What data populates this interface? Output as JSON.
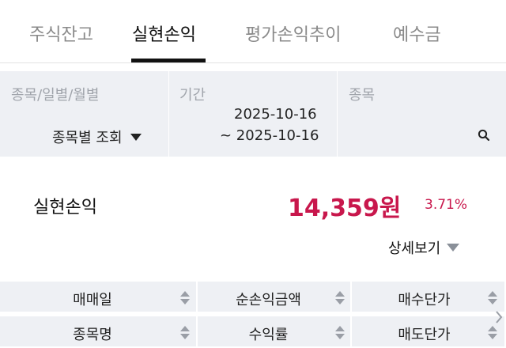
{
  "tabs": [
    {
      "label": "주식잔고",
      "active": false
    },
    {
      "label": "실현손익",
      "active": true
    },
    {
      "label": "평가손익추이",
      "active": false
    },
    {
      "label": "예수금",
      "active": false
    }
  ],
  "filters": {
    "type_label": "종목/일별/월별",
    "type_value": "종목별 조회",
    "period_label": "기간",
    "period_start": "2025-10-16",
    "period_end": "~ 2025-10-16",
    "stock_label": "종목",
    "stock_value": ""
  },
  "summary": {
    "label": "실현손익",
    "amount": "14,359원",
    "rate": "3.71%",
    "color": "#c8174c"
  },
  "detail_label": "상세보기",
  "table": {
    "header_row1": [
      "매매일",
      "순손익금액",
      "매수단가"
    ],
    "header_row2": [
      "종목명",
      "수익률",
      "매도단가"
    ]
  },
  "icons": {
    "search": "search-icon",
    "dropdown": "triangle-down-icon",
    "sort": "sort-icon",
    "scroll": "chevron-right-icon"
  }
}
